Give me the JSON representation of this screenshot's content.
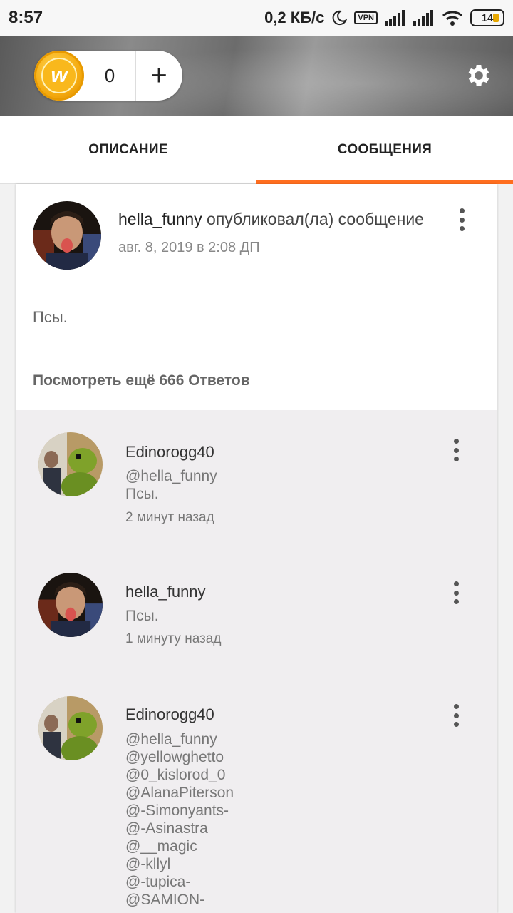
{
  "status_bar": {
    "time": "8:57",
    "speed": "0,2 КБ/с",
    "vpn": "VPN",
    "battery": "14"
  },
  "header": {
    "coins": "0",
    "add": "+"
  },
  "tabs": [
    {
      "label": "ОПИСАНИЕ",
      "active": false
    },
    {
      "label": "СООБЩЕНИЯ",
      "active": true
    }
  ],
  "post": {
    "author": "hella_funny",
    "action": "опубликовал(ла) сообщение",
    "date": "авг. 8, 2019 в 2:08 ДП",
    "text": "Псы.",
    "more_replies": "Посмотреть ещё 666 Ответов"
  },
  "replies": [
    {
      "author": "Edinorogg40",
      "lines": [
        "@hella_funny",
        "Псы."
      ],
      "time": "2 минут назад"
    },
    {
      "author": "hella_funny",
      "lines": [
        "Псы."
      ],
      "time": "1 минуту назад"
    },
    {
      "author": "Edinorogg40",
      "lines": [
        "@hella_funny",
        "@yellowghetto",
        "@0_kislorod_0",
        "@AlanaPiterson",
        "@-Simonyants-",
        "@-Asinastra",
        "@__magic",
        "@-kllyl",
        "@-tupica-",
        "@SAMION-"
      ],
      "time": ""
    }
  ],
  "colors": {
    "accent": "#ff6e1f",
    "coin": "#f4a90e"
  },
  "icons": [
    "moon-icon",
    "signal-icon",
    "wifi-icon",
    "battery-icon",
    "coin-icon",
    "plus-icon",
    "gear-icon",
    "more-vert-icon"
  ]
}
